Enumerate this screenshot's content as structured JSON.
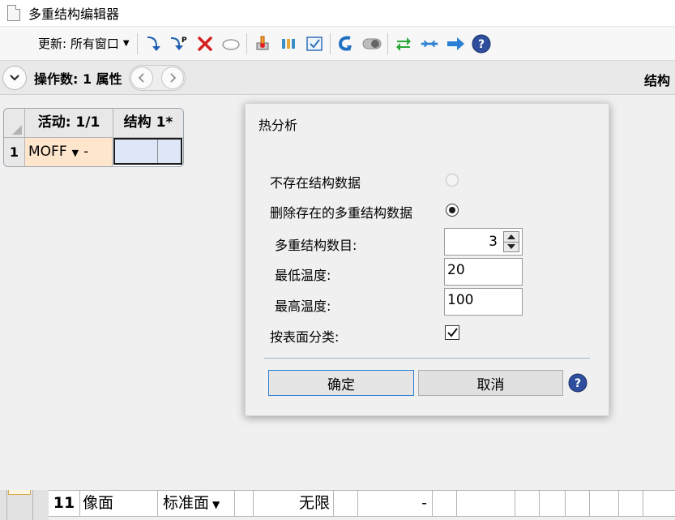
{
  "window": {
    "title": "多重结构编辑器"
  },
  "toolbar": {
    "update_label": "更新: 所有窗口",
    "icons": [
      "insert-config-icon",
      "insert-config-after-icon",
      "delete-config-icon",
      "insert-operand-icon",
      "thermal-analysis-icon",
      "make-thermal-icon",
      "check-icon",
      "undo-icon",
      "toggle-icon",
      "swap-icon",
      "link-icon",
      "forward-icon",
      "help-icon"
    ]
  },
  "operand_bar": {
    "label": "操作数:  1 属性",
    "right_label": "结构"
  },
  "grid": {
    "col_active": "活动: 1/1",
    "col_config": "结构 1*",
    "row_num": "1",
    "operand": "MOFF",
    "dash": "-"
  },
  "dialog": {
    "title": "热分析",
    "radio_no_data": "不存在结构数据",
    "radio_delete": "删除存在的多重结构数据",
    "label_count": "多重结构数目:",
    "count_value": "3",
    "label_min_temp": "最低温度:",
    "min_temp": "20",
    "label_max_temp": "最高温度:",
    "max_temp": "100",
    "label_sort": "按表面分类:",
    "sort_checked": true,
    "ok_label": "确定",
    "cancel_label": "取消"
  },
  "bottom_row": {
    "num": "11",
    "name": "像面",
    "type": "标准面",
    "radius": "无限",
    "dash": "-"
  },
  "colors": {
    "accent_blue": "#2c7fd6",
    "operand_cell": "#fde6cc",
    "selected_cell": "#dde7f7"
  }
}
